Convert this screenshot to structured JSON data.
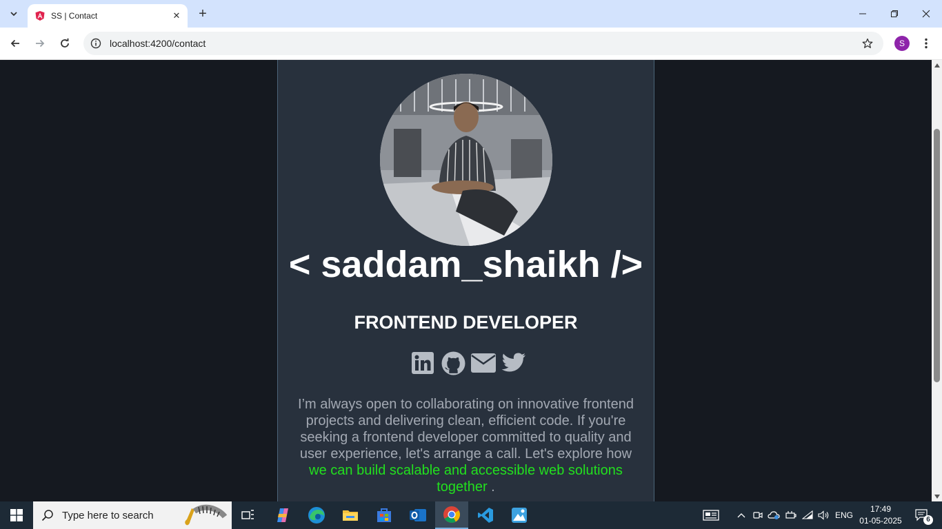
{
  "browser": {
    "tab_title": "SS | Contact",
    "new_tab_label": "+",
    "url": "localhost:4200/contact",
    "profile_initial": "S"
  },
  "page": {
    "name": "< saddam_shaikh />",
    "role": "FRONTEND DEVELOPER",
    "about_plain": "I’m always open to collaborating on innovative frontend projects and delivering clean, efficient code. If you're seeking a frontend developer committed to quality and user experience, let's arrange a call. Let's explore how ",
    "about_highlight": "we can build scalable and accessible web solutions together",
    "about_end": " .",
    "social_icons": [
      "linkedin-icon",
      "github-icon",
      "email-icon",
      "twitter-icon"
    ],
    "colors": {
      "background": "#151920",
      "card": "#28313d",
      "accent": "#22e01e",
      "text_muted": "#a3a9b3"
    }
  },
  "taskbar": {
    "search_placeholder": "Type here to search",
    "language": "ENG",
    "time": "17:49",
    "date": "01-05-2025",
    "notification_count": "6"
  }
}
